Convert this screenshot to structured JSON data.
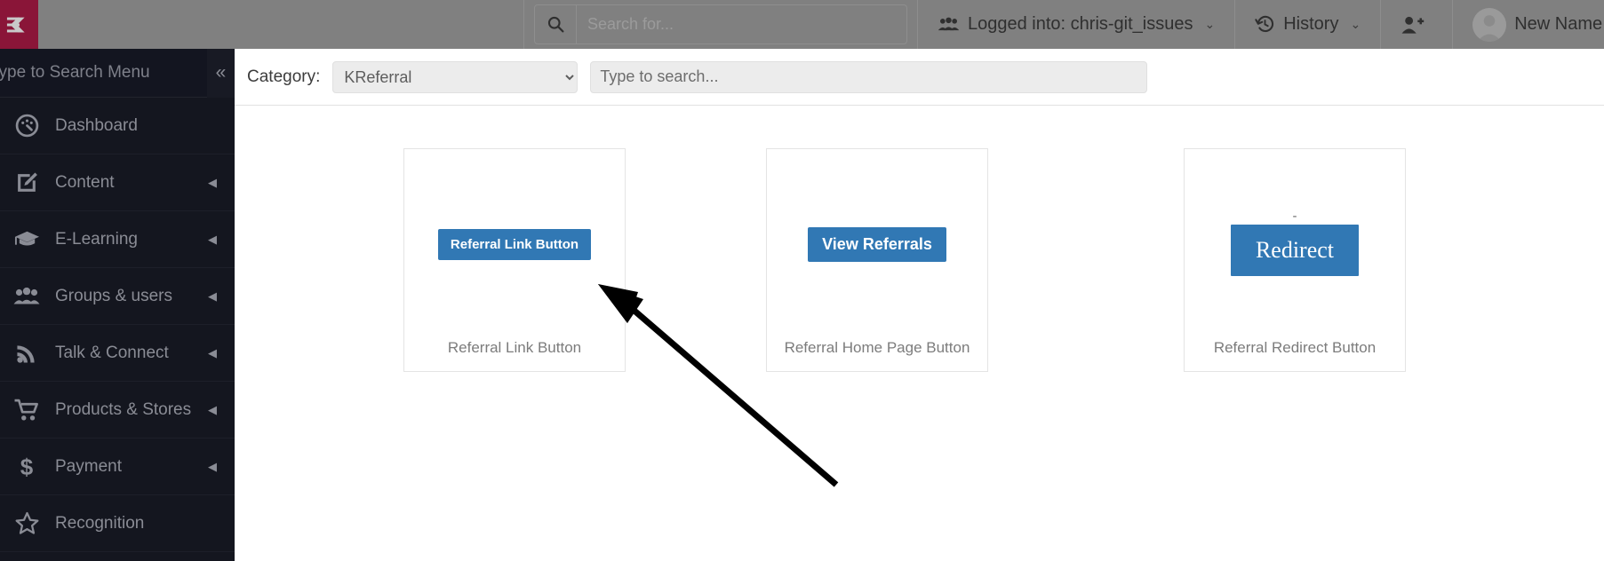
{
  "header": {
    "logo_alt": "KZO logo",
    "search": {
      "placeholder": "Search for...",
      "value": "",
      "icon": "search-icon"
    },
    "logged_into": {
      "label": "Logged into: chris-git_issues",
      "icon": "users-group-icon",
      "caret": "⌄"
    },
    "history": {
      "label": "History",
      "icon": "history-clock-icon",
      "caret": "⌄"
    },
    "add_user": {
      "label": "",
      "icon": "user-plus-icon"
    },
    "account": {
      "label": "New Name",
      "icon": "avatar-icon",
      "caret": "⌄"
    },
    "accent_green": "#1f5b4e",
    "logo_color": "#8a1538",
    "bar_color": "#808080"
  },
  "sidebar": {
    "search_placeholder": "Type to Search Menu",
    "search_value": "",
    "collapse_label": "«",
    "items": [
      {
        "label": "Dashboard",
        "icon": "dashboard-gauge-icon",
        "has_arrow": false
      },
      {
        "label": "Content",
        "icon": "content-edit-icon",
        "has_arrow": true,
        "arrow": "◀"
      },
      {
        "label": "E-Learning",
        "icon": "graduation-cap-icon",
        "has_arrow": true,
        "arrow": "◀"
      },
      {
        "label": "Groups & users",
        "icon": "users-group-icon",
        "has_arrow": true,
        "arrow": "◀"
      },
      {
        "label": "Talk & Connect",
        "icon": "rss-feed-icon",
        "has_arrow": true,
        "arrow": "◀"
      },
      {
        "label": "Products & Stores",
        "icon": "shopping-cart-icon",
        "has_arrow": true,
        "arrow": "◀"
      },
      {
        "label": "Payment",
        "icon": "dollar-sign-icon",
        "has_arrow": true,
        "arrow": "◀"
      },
      {
        "label": "Recognition",
        "icon": "star-outline-icon",
        "has_arrow": false
      }
    ],
    "bg_color": "#14161f",
    "text_color": "#8a8c95"
  },
  "filter_bar": {
    "category_label": "Category:",
    "category_value": "KReferral",
    "category_options": [
      "KReferral"
    ],
    "search_placeholder": "Type to search...",
    "search_value": ""
  },
  "cards": [
    {
      "caption": "Referral Link Button",
      "button_label": "Referral Link Button",
      "button_style": "ref-link",
      "button_color": "#3178b4",
      "has_dash": false
    },
    {
      "caption": "Referral Home Page Button",
      "button_label": "View Referrals",
      "button_style": "view-ref",
      "button_color": "#3178b4",
      "has_dash": false
    },
    {
      "caption": "Referral Redirect Button",
      "button_label": "Redirect",
      "button_style": "redirect",
      "button_color": "#3178b4",
      "has_dash": true,
      "dash": "-"
    }
  ],
  "annotation": {
    "type": "arrow",
    "color": "#000000",
    "points_to": "Referral Link Button card"
  }
}
